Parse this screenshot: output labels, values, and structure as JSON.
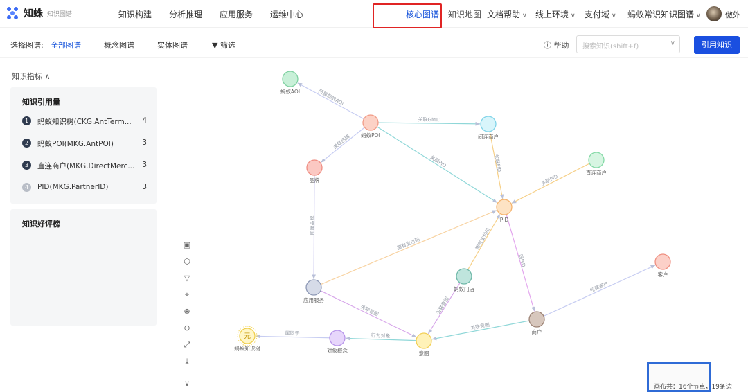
{
  "app": {
    "name": "知蛛",
    "subtitle": "知识图谱"
  },
  "nav": {
    "items": [
      "知识构建",
      "分析推理",
      "应用服务",
      "运维中心"
    ],
    "core_graph": "核心图谱",
    "knowledge_map": "知识地图",
    "doc_help": "文档帮助",
    "online_env": "线上环境",
    "pay_domain": "支付域",
    "ant_graph": "蚂蚁常识知识图谱",
    "user": "傲外"
  },
  "subbar": {
    "select_label": "选择图谱:",
    "all_graph": "全部图谱",
    "concept_graph": "概念图谱",
    "entity_graph": "实体图谱",
    "filter": "筛选",
    "help": "帮助",
    "search_placeholder": "搜索知识(shift+f)",
    "cite_button": "引用知识"
  },
  "metrics": {
    "header": "知识指标",
    "usage_title": "知识引用量",
    "usage_items": [
      {
        "rank": "1",
        "label": "蚂蚁知识树(CKG.AntTerm...",
        "count": "4"
      },
      {
        "rank": "2",
        "label": "蚂蚁POI(MKG.AntPOI)",
        "count": "3"
      },
      {
        "rank": "3",
        "label": "直连商户(MKG.DirectMerc...",
        "count": "3"
      },
      {
        "rank": "4",
        "label": "PID(MKG.PartnerID)",
        "count": "3"
      }
    ],
    "rating_title": "知识好评榜"
  },
  "graph": {
    "nodes": [
      {
        "id": "aoi",
        "label": "蚂蚁AOI",
        "color": "#c8f0d8",
        "stroke": "#7fd1a1"
      },
      {
        "id": "poi",
        "label": "蚂蚁POI",
        "color": "#fcd2c6",
        "stroke": "#f19a85"
      },
      {
        "id": "indirect",
        "label": "间连商户",
        "color": "#d8f5fb",
        "stroke": "#7fd3e8"
      },
      {
        "id": "direct",
        "label": "直连商户",
        "color": "#d7f5e2",
        "stroke": "#84d9a6"
      },
      {
        "id": "brand",
        "label": "品牌",
        "color": "#fbc8c2",
        "stroke": "#ef8c81"
      },
      {
        "id": "pid",
        "label": "PID",
        "color": "#fde3c4",
        "stroke": "#f5b36d"
      },
      {
        "id": "store",
        "label": "蚂蚁门店",
        "color": "#bfe5dd",
        "stroke": "#6fb8a8"
      },
      {
        "id": "customer",
        "label": "客户",
        "color": "#fcd0c8",
        "stroke": "#ef8f80"
      },
      {
        "id": "appsvc",
        "label": "应用服务",
        "color": "#d6dbe8",
        "stroke": "#8d98b5"
      },
      {
        "id": "merchant",
        "label": "商户",
        "color": "#d7c7bd",
        "stroke": "#9c8274"
      },
      {
        "id": "tree",
        "label": "蚂蚁知识树",
        "color": "#fff6c8",
        "stroke": "#f0cf4a"
      },
      {
        "id": "objconcept",
        "label": "对象概念",
        "color": "#e7d6fb",
        "stroke": "#b794ea"
      },
      {
        "id": "intent",
        "label": "意图",
        "color": "#fff2b8",
        "stroke": "#f2cf55"
      }
    ],
    "tree_glyph": "元",
    "edges": [
      {
        "from": "poi",
        "to": "aoi",
        "label": "所属蚂蚁AOI",
        "color": "#c7cdf2"
      },
      {
        "from": "poi",
        "to": "indirect",
        "label": "关联GMID",
        "color": "#8fd7d8"
      },
      {
        "from": "poi",
        "to": "brand",
        "label": "关联品牌",
        "color": "#c7cdf2"
      },
      {
        "from": "poi",
        "to": "pid",
        "label": "关联PID",
        "color": "#8fd7d8"
      },
      {
        "from": "direct",
        "to": "pid",
        "label": "关联PID",
        "color": "#f6cf86"
      },
      {
        "from": "indirect",
        "to": "pid",
        "label": "关联PID",
        "color": "#f6cf86"
      },
      {
        "from": "brand",
        "to": "appsvc",
        "label": "所属品牌",
        "color": "#c9c6ee"
      },
      {
        "from": "appsvc",
        "to": "pid",
        "label": "拥有支付码",
        "color": "#f8d3a2"
      },
      {
        "from": "store",
        "to": "pid",
        "label": "拥有支付码",
        "color": "#f6cf86"
      },
      {
        "from": "pid",
        "to": "merchant",
        "label": "同PID",
        "color": "#e3a6ee"
      },
      {
        "from": "merchant",
        "to": "customer",
        "label": "所属客户",
        "color": "#c7cdf2"
      },
      {
        "from": "appsvc",
        "to": "intent",
        "label": "关联意图",
        "color": "#d7a6ea"
      },
      {
        "from": "store",
        "to": "intent",
        "label": "关联意图",
        "color": "#d7a6ea"
      },
      {
        "from": "merchant",
        "to": "intent",
        "label": "关联意图",
        "color": "#8fd7d8"
      },
      {
        "from": "intent",
        "to": "objconcept",
        "label": "行为对象",
        "color": "#8fd7d8"
      },
      {
        "from": "objconcept",
        "to": "tree",
        "label": "属同于",
        "color": "#c7cdf2"
      }
    ]
  },
  "minimap": {
    "footer": "画布共：16个节点，19条边"
  }
}
